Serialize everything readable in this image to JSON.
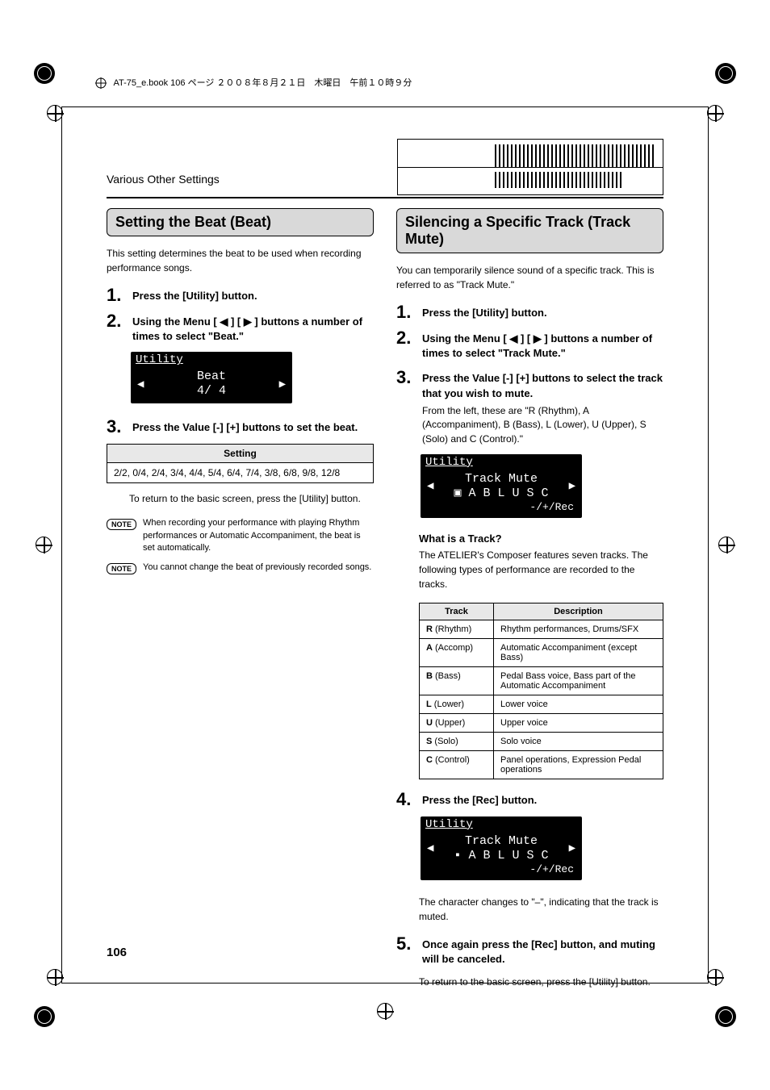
{
  "meta": {
    "header": "AT-75_e.book 106 ページ ２００８年８月２１日　木曜日　午前１０時９分"
  },
  "breadcrumb": "Various Other Settings",
  "pageNumber": "106",
  "left": {
    "title": "Setting the Beat (Beat)",
    "intro": "This setting determines the beat to be used when recording performance songs.",
    "steps": {
      "s1": "Press the [Utility] button.",
      "s2": "Using the Menu [ ◀ ] [ ▶ ] buttons a number of times to select \"Beat.\"",
      "s3": "Press the Value [-] [+] buttons to set the beat."
    },
    "lcd": {
      "title": "Utility",
      "line1": "Beat",
      "line2": "4/ 4"
    },
    "tableHeader": "Setting",
    "tableValue": "2/2, 0/4, 2/4, 3/4, 4/4, 5/4, 6/4, 7/4, 3/8, 6/8, 9/8, 12/8",
    "return": "To return to the basic screen, press the [Utility] button.",
    "note1Label": "NOTE",
    "note1": "When recording your performance with playing Rhythm performances or Automatic Accompaniment, the beat is set automatically.",
    "note2Label": "NOTE",
    "note2": "You cannot change the beat of previously recorded songs."
  },
  "right": {
    "title": "Silencing a Specific Track (Track Mute)",
    "intro": "You can temporarily silence sound of a specific track. This is referred to as \"Track Mute.\"",
    "steps": {
      "s1": "Press the [Utility] button.",
      "s2": "Using the Menu [ ◀ ] [ ▶ ] buttons a number of times to select \"Track Mute.\"",
      "s3": "Press the Value [-] [+] buttons to select the track that you wish to mute.",
      "s3sub": "From the left, these are \"R (Rhythm), A (Accompaniment), B (Bass), L (Lower), U (Upper), S (Solo) and C (Control).\"",
      "s4": "Press the [Rec] button.",
      "s5": "Once again press the [Rec] button, and muting will be canceled."
    },
    "lcd1": {
      "title": "Utility",
      "line1": "Track Mute",
      "line2": "▣ A B L U S C",
      "line3": "-/+/Rec"
    },
    "lcd2": {
      "title": "Utility",
      "line1": "Track Mute",
      "line2": "▪ A B L U S C",
      "line3": "-/+/Rec"
    },
    "whatHead": "What is a Track?",
    "whatBody": "The ATELIER's Composer features seven tracks. The following types of performance are recorded to the tracks.",
    "descHeaders": {
      "track": "Track",
      "desc": "Description"
    },
    "rows": [
      {
        "kb": "R",
        "k": " (Rhythm)",
        "d": "Rhythm performances, Drums/SFX"
      },
      {
        "kb": "A",
        "k": " (Accomp)",
        "d": "Automatic Accompaniment (except Bass)"
      },
      {
        "kb": "B",
        "k": " (Bass)",
        "d": "Pedal Bass voice, Bass part of the Automatic Accompaniment"
      },
      {
        "kb": "L",
        "k": " (Lower)",
        "d": "Lower voice"
      },
      {
        "kb": "U",
        "k": " (Upper)",
        "d": "Upper voice"
      },
      {
        "kb": "S",
        "k": " (Solo)",
        "d": "Solo voice"
      },
      {
        "kb": "C",
        "k": " (Control)",
        "d": "Panel operations, Expression Pedal operations"
      }
    ],
    "afterRec": "The character changes to \"–\", indicating that the track is muted.",
    "return": "To return to the basic screen, press the [Utility] button."
  }
}
